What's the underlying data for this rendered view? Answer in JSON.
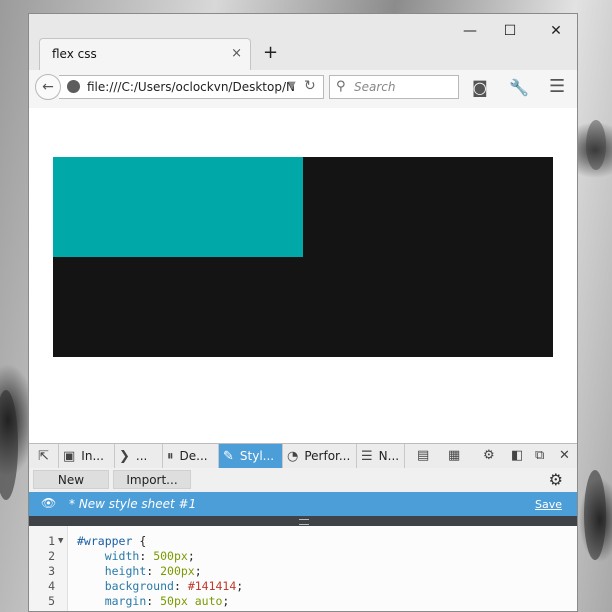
{
  "browser": {
    "tab_title": "flex css",
    "tab_close": "×",
    "new_tab": "+",
    "url": "file:///C:/Users/oclockvn/Desktop/N",
    "search_placeholder": "Search",
    "window_controls": {
      "minimize": "—",
      "maximize": "☐",
      "close": "✕"
    },
    "icons": [
      "back-arrow-icon",
      "globe-icon",
      "dropdown-arrow-icon",
      "reload-icon",
      "search-icon",
      "pocket-icon",
      "wrench-icon",
      "menu-icon"
    ]
  },
  "page": {
    "wrapper_color": "#141414",
    "box_color": "#00a8a8"
  },
  "devtools": {
    "tabs": [
      {
        "label": "",
        "icon": "pick-element-icon"
      },
      {
        "label": "In...",
        "icon": "inspector-icon"
      },
      {
        "label": "...",
        "icon": "console-icon"
      },
      {
        "label": "De...",
        "icon": "debugger-icon"
      },
      {
        "label": "Styl...",
        "icon": "style-editor-icon",
        "active": true
      },
      {
        "label": "Perfor...",
        "icon": "performance-icon"
      },
      {
        "label": "N...",
        "icon": "network-icon"
      }
    ],
    "accent": "#4c9ed9",
    "style_editor": {
      "new_label": "New",
      "import_label": "Import...",
      "sheet_name": "* New style sheet #1",
      "save_label": "Save"
    },
    "code": {
      "line_numbers": [
        "1",
        "2",
        "3",
        "4",
        "5"
      ],
      "selector": "#wrapper",
      "brace_open": "{",
      "declarations": [
        {
          "prop": "width",
          "value": "500px"
        },
        {
          "prop": "height",
          "value": "200px"
        },
        {
          "prop": "background",
          "value": "#141414"
        },
        {
          "prop": "margin",
          "value": "50px auto"
        }
      ],
      "brace_close": "}"
    }
  }
}
